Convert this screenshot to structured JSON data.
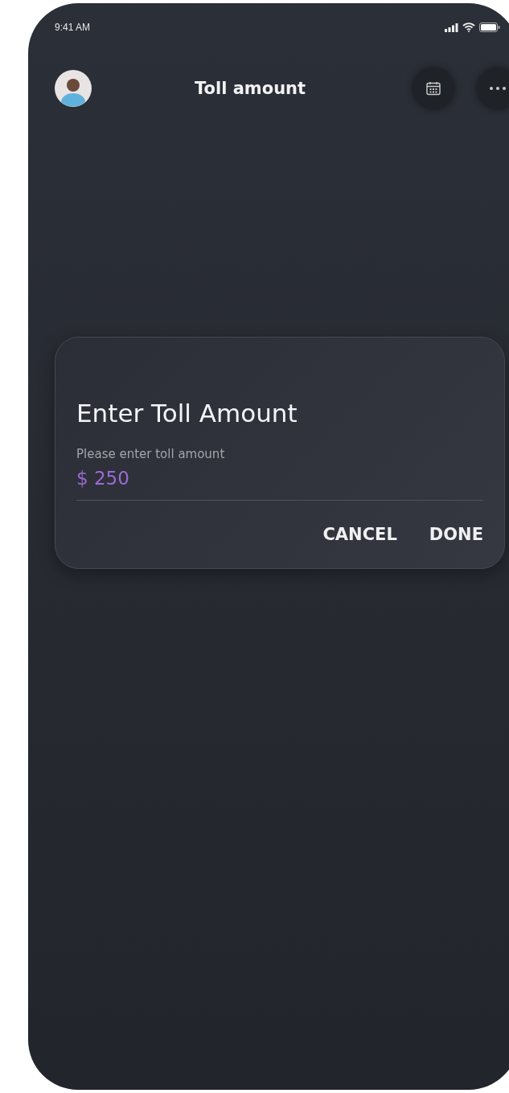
{
  "status_bar": {
    "time": "9:41 AM"
  },
  "header": {
    "title": "Toll amount"
  },
  "dialog": {
    "title": "Enter Toll Amount",
    "field": {
      "label": "Please enter toll amount",
      "value": "$ 250"
    },
    "buttons": [
      {
        "label": "CANCEL"
      },
      {
        "label": "DONE"
      }
    ]
  }
}
